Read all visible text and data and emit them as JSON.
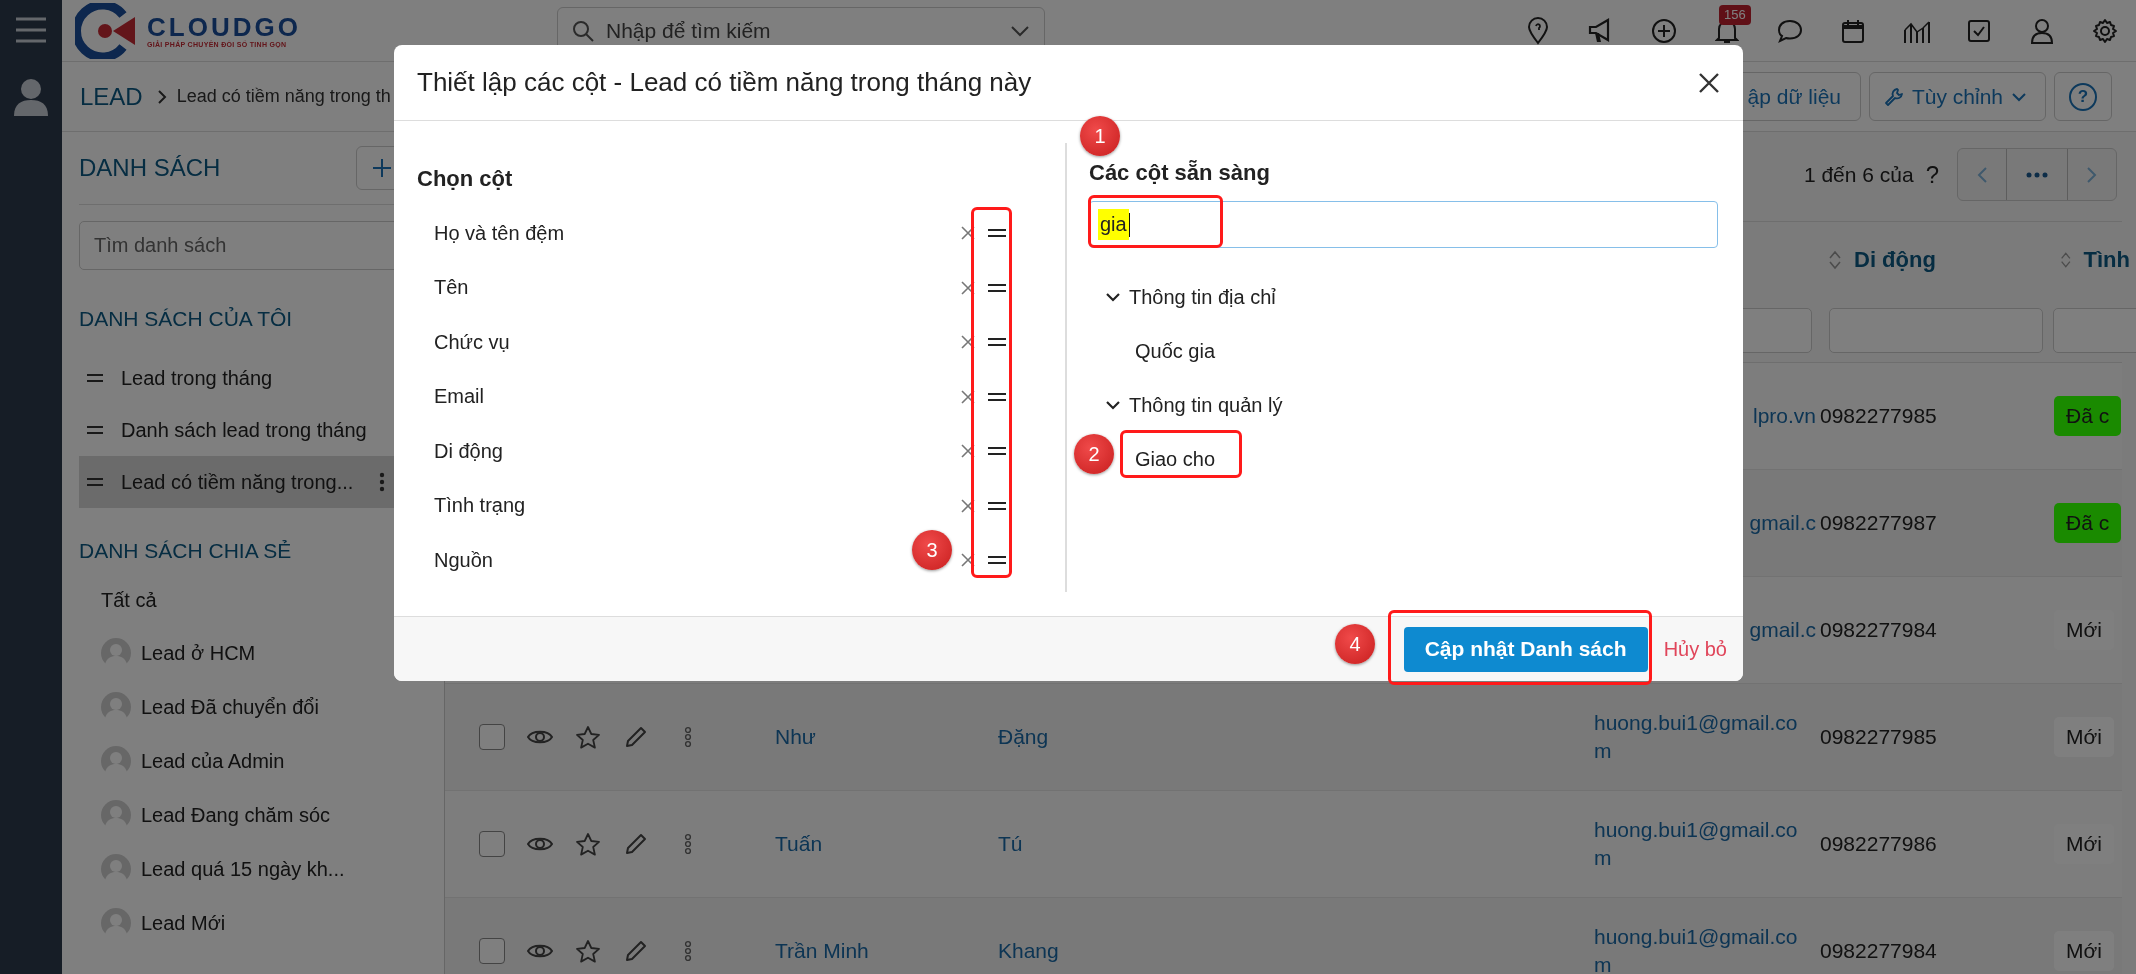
{
  "topbar": {
    "logo": {
      "name": "CLOUDGO",
      "tagline": "GIẢI PHÁP CHUYỂN ĐỔI SỐ TINH GỌN"
    },
    "search": {
      "placeholder": "Nhập để tìm kiếm"
    },
    "notification_count": "156"
  },
  "breadcrumb": {
    "module": "LEAD",
    "current": "Lead có tiềm năng trong th"
  },
  "actions": [
    {
      "label": "ập dữ liệu",
      "kind": "plain"
    },
    {
      "label": "Tùy chỉnh",
      "kind": "menu"
    },
    {
      "label": "?",
      "kind": "help"
    }
  ],
  "sidebar": {
    "title": "DANH SÁCH",
    "search": {
      "placeholder": "Tìm danh sách"
    },
    "my_lists": {
      "heading": "DANH SÁCH CỦA TÔI",
      "items": [
        {
          "label": "Lead trong tháng",
          "selected": false
        },
        {
          "label": "Danh sách lead trong tháng",
          "selected": false
        },
        {
          "label": "Lead có tiềm năng trong...",
          "selected": true
        }
      ]
    },
    "shared_lists": {
      "heading": "DANH SÁCH CHIA SẺ",
      "items": [
        {
          "label": "Tất cả",
          "kind": "all"
        },
        {
          "label": "Lead ở HCM",
          "kind": "user"
        },
        {
          "label": "Lead Đã chuyển đổi",
          "kind": "user"
        },
        {
          "label": "Lead của Admin",
          "kind": "user"
        },
        {
          "label": "Lead Đang chăm sóc",
          "kind": "user"
        },
        {
          "label": "Lead quá 15 ngày kh...",
          "kind": "user"
        },
        {
          "label": "Lead Mới",
          "kind": "user"
        }
      ]
    }
  },
  "pager": {
    "range": "1 đến 6 của",
    "total": "?"
  },
  "table": {
    "columns": [
      {
        "label": "Di động"
      },
      {
        "label": "Tình"
      }
    ],
    "rows": [
      {
        "email": "lpro.vn",
        "phone": "0982277985",
        "status": {
          "label": "Đã c",
          "color": "#1a8a00"
        }
      },
      {
        "email": "gmail.c",
        "phone": "0982277987",
        "status": {
          "label": "Đã c",
          "color": "#1a8a00"
        }
      },
      {
        "email": "gmail.c",
        "phone": "0982277984",
        "status": {
          "label": "Mới"
        }
      },
      {
        "checked": false,
        "first_name": "Như",
        "last_name": "Đặng",
        "email": "huong.bui1@gmail.com",
        "phone": "0982277985",
        "status": {
          "label": "Mới"
        }
      },
      {
        "checked": false,
        "first_name": "Tuấn",
        "last_name": "Tú",
        "email": "huong.bui1@gmail.com",
        "phone": "0982277986",
        "status": {
          "label": "Mới"
        }
      },
      {
        "checked": false,
        "first_name": "Trần Minh",
        "last_name": "Khang",
        "email": "huong.bui1@gmail.com",
        "phone": "0982277984",
        "status": {
          "label": "Mới"
        }
      }
    ]
  },
  "modal": {
    "title": "Thiết lập các cột - Lead có tiềm năng trong tháng này",
    "selected_heading": "Chọn cột",
    "selected_columns": [
      {
        "label": "Họ và tên đệm"
      },
      {
        "label": "Tên"
      },
      {
        "label": "Chức vụ"
      },
      {
        "label": "Email"
      },
      {
        "label": "Di động"
      },
      {
        "label": "Tình trạng"
      },
      {
        "label": "Nguồn"
      }
    ],
    "available_heading": "Các cột sẵn sàng",
    "filter_value": "gia",
    "groups": [
      {
        "label": "Thông tin địa chỉ",
        "expanded": true,
        "children": [
          {
            "label": "Quốc gia"
          }
        ]
      },
      {
        "label": "Thông tin quản lý",
        "expanded": true,
        "children": [
          {
            "label": "Giao cho"
          }
        ]
      }
    ],
    "primary_button": "Cập nhật Danh sách",
    "cancel_link": "Hủy bỏ"
  },
  "annotations": [
    {
      "label": "1"
    },
    {
      "label": "2"
    },
    {
      "label": "3"
    },
    {
      "label": "4"
    }
  ]
}
